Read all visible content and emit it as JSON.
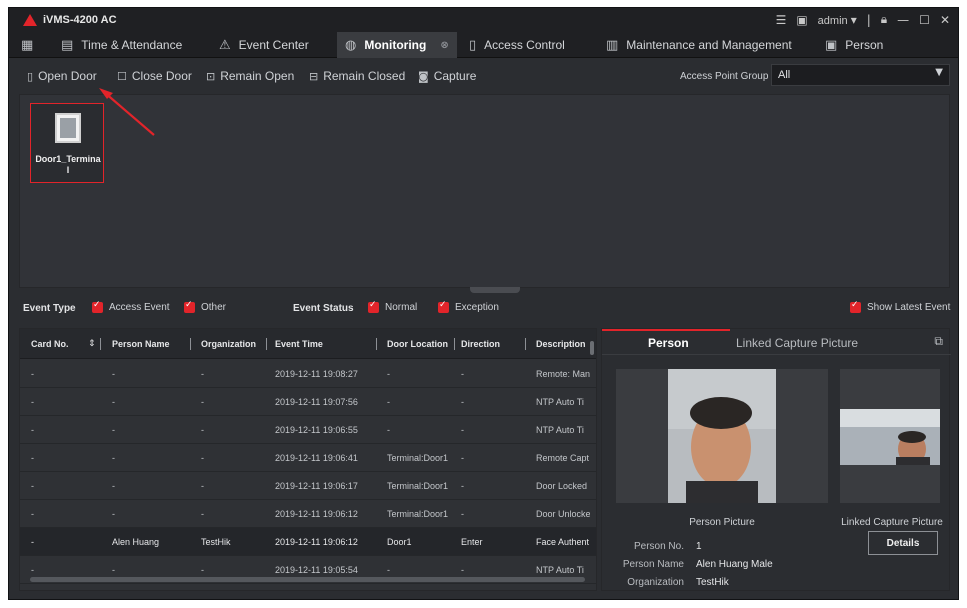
{
  "app": {
    "title": "iVMS-4200 AC",
    "user": "admin",
    "logo_icon": "triangle-logo-icon"
  },
  "nav": [
    {
      "label": "",
      "icon": "grid-icon"
    },
    {
      "label": "Time & Attendance",
      "icon": "calendar-icon"
    },
    {
      "label": "Event Center",
      "icon": "alarm-icon"
    },
    {
      "label": "Monitoring",
      "icon": "globe-icon",
      "active": true
    },
    {
      "label": "Access Control",
      "icon": "door-icon"
    },
    {
      "label": "Maintenance and Management",
      "icon": "server-icon"
    },
    {
      "label": "Person",
      "icon": "person-card-icon"
    }
  ],
  "toolbar": {
    "open_door": "Open Door",
    "close_door": "Close Door",
    "remain_open": "Remain Open",
    "remain_closed": "Remain Closed",
    "capture": "Capture",
    "access_point_group_label": "Access Point Group",
    "access_point_group_value": "All"
  },
  "doors": [
    {
      "label": "Door1_Terminal"
    }
  ],
  "filters": {
    "event_type_label": "Event Type",
    "access_event": "Access Event",
    "other": "Other",
    "event_status_label": "Event Status",
    "normal": "Normal",
    "exception": "Exception",
    "show_latest": "Show Latest Event"
  },
  "table": {
    "headers": [
      "Card No.",
      "Person Name",
      "Organization",
      "Event Time",
      "Door Location",
      "Direction",
      "Description"
    ],
    "rows": [
      [
        "-",
        "-",
        "-",
        "2019-12-11 19:08:27",
        "-",
        "-",
        "Remote: Man"
      ],
      [
        "-",
        "-",
        "-",
        "2019-12-11 19:07:56",
        "-",
        "-",
        "NTP Auto Ti"
      ],
      [
        "-",
        "-",
        "-",
        "2019-12-11 19:06:55",
        "-",
        "-",
        "NTP Auto Ti"
      ],
      [
        "-",
        "-",
        "-",
        "2019-12-11 19:06:41",
        "Terminal:Door1",
        "-",
        "Remote Capt"
      ],
      [
        "-",
        "-",
        "-",
        "2019-12-11 19:06:17",
        "Terminal:Door1",
        "-",
        "Door Locked"
      ],
      [
        "-",
        "-",
        "-",
        "2019-12-11 19:06:12",
        "Terminal:Door1",
        "-",
        "Door Unlocke"
      ],
      [
        "-",
        "Alen Huang",
        "TestHik",
        "2019-12-11 19:06:12",
        "Door1",
        "Enter",
        "Face Authent"
      ],
      [
        "-",
        "-",
        "-",
        "2019-12-11 19:05:54",
        "-",
        "-",
        "NTP Auto Ti"
      ]
    ],
    "highlight_row": 6
  },
  "person_panel": {
    "tab_person": "Person",
    "tab_linked": "Linked Capture Picture",
    "person_picture_label": "Person Picture",
    "linked_picture_label": "Linked Capture Picture",
    "person_no_label": "Person No.",
    "person_no": "1",
    "person_name_label": "Person Name",
    "person_name": "Alen Huang  Male",
    "organization_label": "Organization",
    "organization": "TestHik",
    "details_button": "Details"
  },
  "colors": {
    "accent": "#e2242a",
    "background": "#2b2d31",
    "titlebar": "#1f2023"
  }
}
